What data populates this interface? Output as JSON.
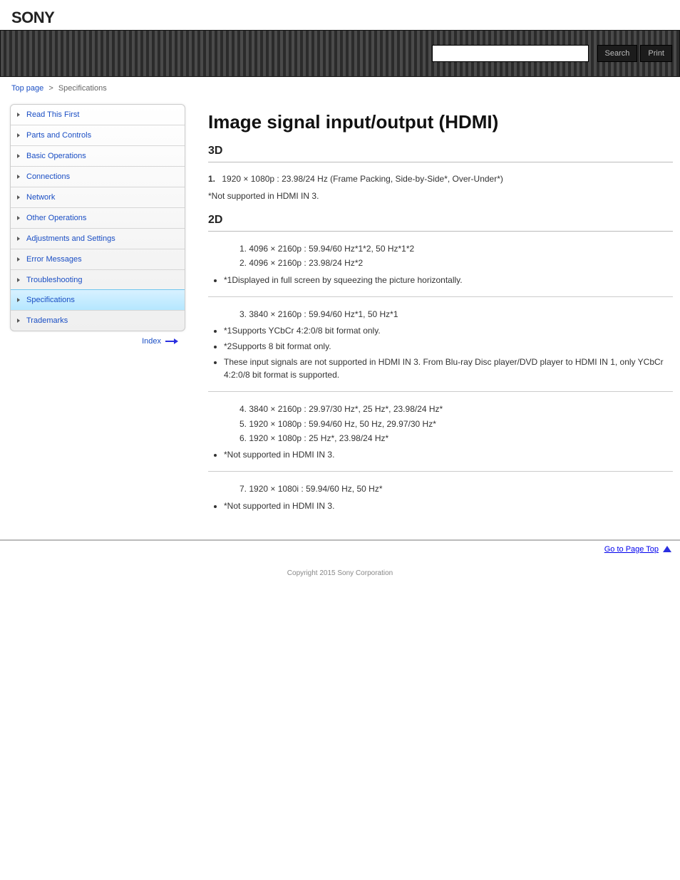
{
  "brand": "SONY",
  "banner": {
    "search_placeholder": "",
    "search_btn": "Search",
    "print_btn": "Print"
  },
  "breadcrumb": {
    "top": "Top page",
    "sep": ">",
    "current": "Specifications"
  },
  "sidebar": {
    "items": [
      "Read This First",
      "Parts and Controls",
      "Basic Operations",
      "Connections",
      "Network",
      "Other Operations",
      "Adjustments and Settings",
      "Error Messages",
      "Troubleshooting",
      "Specifications",
      "Trademarks"
    ],
    "active_index": 9,
    "index_link": "Index"
  },
  "main": {
    "title": "Image signal input/output (HDMI)",
    "sections": [
      {
        "heading": "3D",
        "lines": [
          {
            "num": "1.",
            "text": "1920 × 1080p : 23.98/24 Hz (Frame Packing, Side-by-Side*, Over-Under*)"
          }
        ],
        "note": "*Not supported in HDMI IN 3."
      },
      {
        "heading": "2D",
        "lines": [
          {
            "num": "1.",
            "text": "4096 × 2160p : 59.94/60 Hz*1*2, 50 Hz*1*2"
          },
          {
            "num": "2.",
            "text": "4096 × 2160p : 23.98/24 Hz*2"
          }
        ],
        "bullets": [
          "*1Displayed in full screen by squeezing the picture horizontally."
        ]
      },
      {
        "lines": [
          {
            "num": "3.",
            "text": "3840 × 2160p : 59.94/60 Hz*1, 50 Hz*1"
          }
        ],
        "bullets": [
          "*1Supports YCbCr 4:2:0/8 bit format only.",
          "*2Supports 8 bit format only.",
          "These input signals are not supported in HDMI IN 3. From Blu-ray Disc player/DVD player to HDMI IN 1, only YCbCr 4:2:0/8 bit format is supported."
        ]
      },
      {
        "lines": [
          {
            "num": "4.",
            "text": "3840 × 2160p : 29.97/30 Hz*, 25 Hz*, 23.98/24 Hz*"
          },
          {
            "num": "5.",
            "text": "1920 × 1080p : 59.94/60 Hz, 50 Hz, 29.97/30 Hz*"
          },
          {
            "num": "6.",
            "text": "1920 × 1080p : 25 Hz*, 23.98/24 Hz*"
          }
        ],
        "bullets": [
          "*Not supported in HDMI IN 3."
        ]
      },
      {
        "lines": [
          {
            "num": "7.",
            "text": "1920 × 1080i : 59.94/60 Hz, 50 Hz*"
          }
        ],
        "bullets": [
          "*Not supported in HDMI IN 3."
        ]
      }
    ]
  },
  "footer": {
    "top_link": "Go to Page Top",
    "copyright": "Copyright 2015 Sony Corporation"
  }
}
